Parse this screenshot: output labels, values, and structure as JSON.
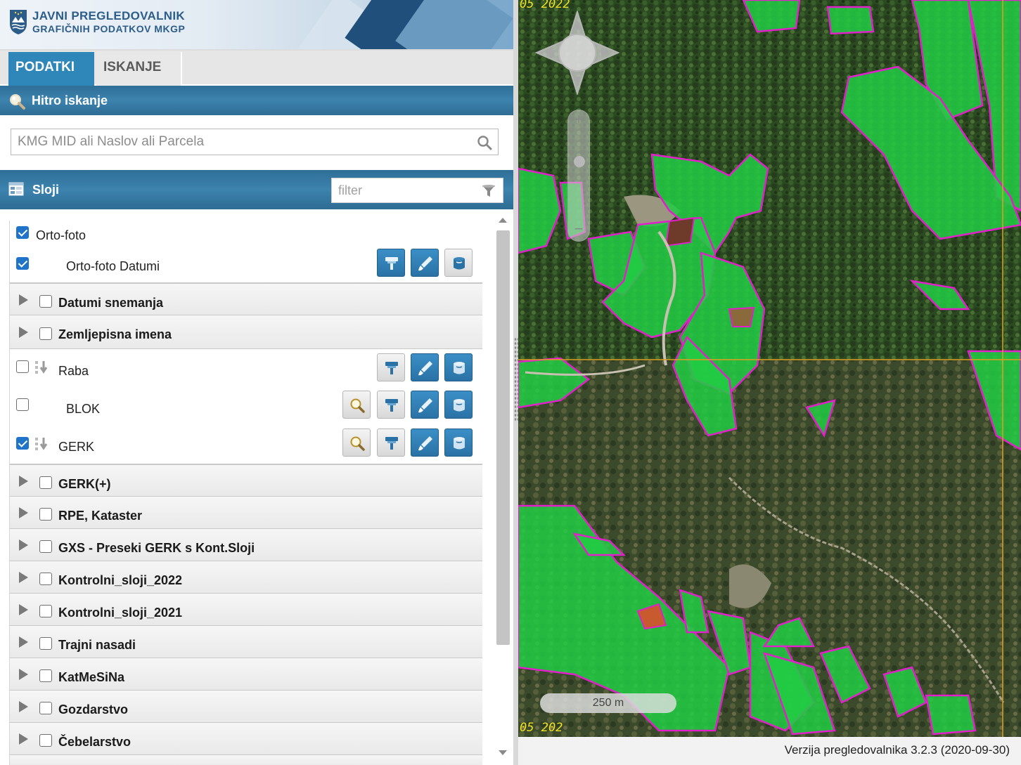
{
  "banner": {
    "line1": "JAVNI PREGLEDOVALNIK",
    "line2": "GRAFIČNIH PODATKOV MKGP"
  },
  "tabs": [
    {
      "label": "PODATKI",
      "active": true
    },
    {
      "label": "ISKANJE",
      "active": false
    }
  ],
  "quick_search": {
    "title": "Hitro iskanje",
    "placeholder": "KMG MID ali Naslov ali Parcela",
    "value": ""
  },
  "layers_panel": {
    "title": "Sloji",
    "filter_placeholder": "filter"
  },
  "layers": [
    {
      "label": "Orto-foto",
      "checked": true,
      "type": "item"
    },
    {
      "label": "Orto-foto Datumi",
      "checked": true,
      "type": "item",
      "buttons": [
        "style",
        "edit",
        "export"
      ]
    },
    {
      "label": "Datumi snemanja",
      "checked": false,
      "type": "group"
    },
    {
      "label": "Zemljepisna imena",
      "checked": false,
      "type": "group"
    },
    {
      "label": "Raba",
      "checked": false,
      "type": "item",
      "buttons": [
        "style",
        "edit",
        "export"
      ]
    },
    {
      "label": "BLOK",
      "checked": false,
      "type": "item",
      "buttons": [
        "zoom",
        "style",
        "edit",
        "export"
      ]
    },
    {
      "label": "GERK",
      "checked": true,
      "type": "item",
      "buttons": [
        "zoom",
        "style",
        "edit",
        "export"
      ]
    },
    {
      "label": "GERK(+)",
      "checked": false,
      "type": "group"
    },
    {
      "label": "RPE, Kataster",
      "checked": false,
      "type": "group"
    },
    {
      "label": "GXS - Preseki GERK s Kont.Sloji",
      "checked": false,
      "type": "group"
    },
    {
      "label": "Kontrolni_sloji_2022",
      "checked": false,
      "type": "group"
    },
    {
      "label": "Kontrolni_sloji_2021",
      "checked": false,
      "type": "group"
    },
    {
      "label": "Trajni nasadi",
      "checked": false,
      "type": "group"
    },
    {
      "label": "KatMeSiNa",
      "checked": false,
      "type": "group"
    },
    {
      "label": "Gozdarstvo",
      "checked": false,
      "type": "group"
    },
    {
      "label": "Čebelarstvo",
      "checked": false,
      "type": "group"
    }
  ],
  "map": {
    "date_top": "05 2022",
    "date_bottom": "05 202",
    "scale_label": "250 m",
    "version": "Verzija pregledovalnika 3.2.3 (2020-09-30)"
  },
  "colors": {
    "accent": "#2f86b8",
    "header": "#2f6f98",
    "parcel_fill": "#22cc44",
    "parcel_border": "#e020c8",
    "gridline": "#e0a020"
  }
}
